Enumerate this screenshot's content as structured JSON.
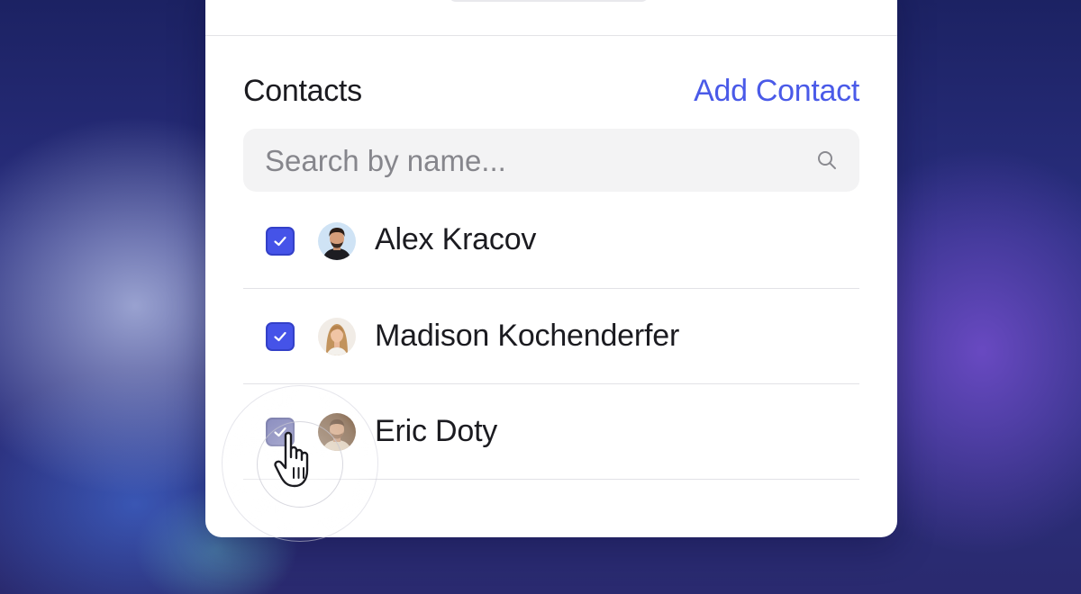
{
  "contacts": {
    "title": "Contacts",
    "add_label": "Add Contact",
    "search": {
      "placeholder": "Search by name...",
      "value": ""
    },
    "items": [
      {
        "name": "Alex Kracov",
        "checked": true
      },
      {
        "name": "Madison Kochenderfer",
        "checked": true
      },
      {
        "name": "Eric Doty",
        "checked": true
      }
    ]
  },
  "colors": {
    "accent": "#4a5ae8",
    "checkbox": "#4553e8",
    "background": "#2a2f80"
  },
  "icons": [
    "search-icon",
    "check-icon",
    "avatar",
    "hand-cursor-icon"
  ]
}
